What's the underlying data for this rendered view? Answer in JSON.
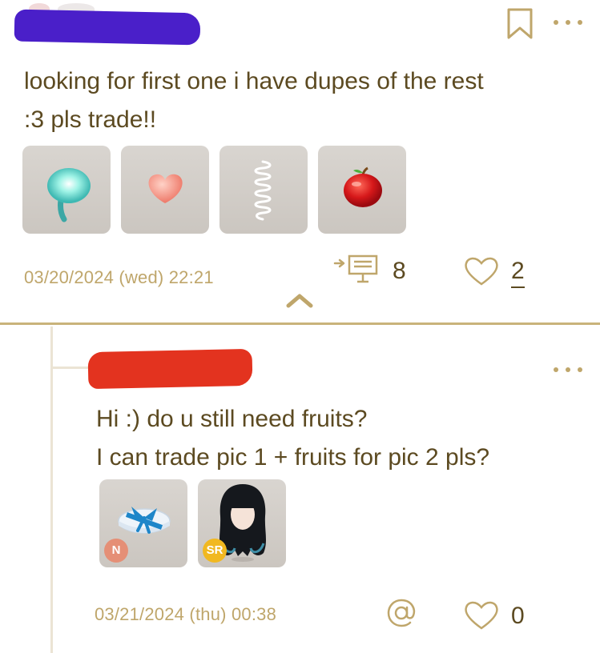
{
  "post": {
    "text": "looking for first one i have dupes of the rest\n:3 pls trade!!",
    "items": [
      {
        "icon": "lollipop-icon"
      },
      {
        "icon": "heart-item-icon"
      },
      {
        "icon": "spring-coil-icon"
      },
      {
        "icon": "apple-icon"
      }
    ],
    "date": "03/20/2024 (wed) 22:21",
    "reply_count": "8",
    "like_count": "2"
  },
  "reply": {
    "text": "Hi :) do u still need fruits?\nI can trade pic 1 + fruits for pic 2 pls?",
    "items": [
      {
        "icon": "gift-box-icon",
        "rarity": "N",
        "rarity_color": "#e58f76"
      },
      {
        "icon": "hairstyle-icon",
        "rarity": "SR",
        "rarity_color": "#f1b820"
      }
    ],
    "date": "03/21/2024 (thu) 00:38",
    "like_count": "0"
  },
  "colors": {
    "text": "#5c4a21",
    "accent": "#bfa66b",
    "divider": "#c9b37a",
    "redact_blue": "#4a1fc9",
    "redact_red": "#e3331f"
  }
}
